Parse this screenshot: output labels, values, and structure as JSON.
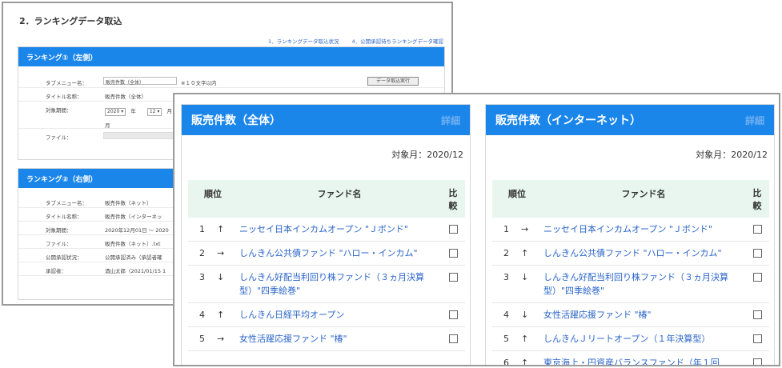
{
  "background": {
    "title": "2．ランキングデータ取込",
    "links": [
      "1．ランキングデータ取込状況",
      "4．公開承認待ちランキングデータ確認"
    ],
    "panel1": {
      "header": "ランキング①（左側）",
      "tab_menu_label": "タブメニュー名：",
      "tab_menu_value": "販売件数（全体）",
      "tab_menu_note": "※１０文字以内",
      "import_button": "データ取込実行",
      "title_label": "タイトル名称：",
      "title_value": "販売件数（全体）",
      "period_label": "対象期間：",
      "year_select": "2020",
      "year_unit": "年",
      "month_select": "12",
      "month_unit": "月",
      "file_label": "ファイル："
    },
    "panel2": {
      "header": "ランキング②（右側）",
      "rows": [
        {
          "label": "タブメニュー名：",
          "value": "販売件数（ネット）"
        },
        {
          "label": "タイトル名称：",
          "value": "販売件数（インターネッ"
        },
        {
          "label": "対象期間：",
          "value": "2020年12月01日 ～ 2020"
        },
        {
          "label": "ファイル：",
          "value": "販売件数（ネット）.txt"
        },
        {
          "label": "公開承認状況：",
          "value": "公開承認済み（承認者確"
        },
        {
          "label": "承認者：",
          "value": "酒山太郎（2021/01/15 1"
        }
      ]
    }
  },
  "left_card": {
    "title": "販売件数（全体）",
    "detail": "詳細",
    "month": "対象月：2020/12",
    "headers": {
      "rank": "順位",
      "name": "ファンド名",
      "compare": "比較"
    },
    "rows": [
      {
        "rank": "1",
        "arrow": "↑",
        "name": "ニッセイ日本インカムオープン \"Ｊボンド\""
      },
      {
        "rank": "2",
        "arrow": "→",
        "name": "しんきん公共債ファンド \"ハロー・インカム\""
      },
      {
        "rank": "3",
        "arrow": "↓",
        "name": "しんきん好配当利回り株ファンド（３ヵ月決算型）\"四季絵巻\""
      },
      {
        "rank": "4",
        "arrow": "↑",
        "name": "しんきん日経平均オープン"
      },
      {
        "rank": "5",
        "arrow": "→",
        "name": "女性活躍応援ファンド \"椿\""
      }
    ]
  },
  "right_card": {
    "title": "販売件数（インターネット）",
    "detail": "詳細",
    "month": "対象月：2020/12",
    "headers": {
      "rank": "順位",
      "name": "ファンド名",
      "compare": "比較"
    },
    "rows": [
      {
        "rank": "1",
        "arrow": "→",
        "name": "ニッセイ日本インカムオープン \"Ｊボンド\""
      },
      {
        "rank": "2",
        "arrow": "↑",
        "name": "しんきん公共債ファンド \"ハロー・インカム\""
      },
      {
        "rank": "3",
        "arrow": "↓",
        "name": "しんきん好配当利回り株ファンド（３ヵ月決算型）\"四季絵巻\""
      },
      {
        "rank": "4",
        "arrow": "↓",
        "name": "女性活躍応援ファンド \"椿\""
      },
      {
        "rank": "5",
        "arrow": "↑",
        "name": "しんきんＪリートオープン（１年決算型）"
      },
      {
        "rank": "6",
        "arrow": "↑",
        "name": "東京海上・円資産バランスファンド（年１回"
      }
    ]
  },
  "colors": {
    "accent": "#1b86ea",
    "header_bg": "#e8f6ef",
    "link": "#2a64c8"
  }
}
